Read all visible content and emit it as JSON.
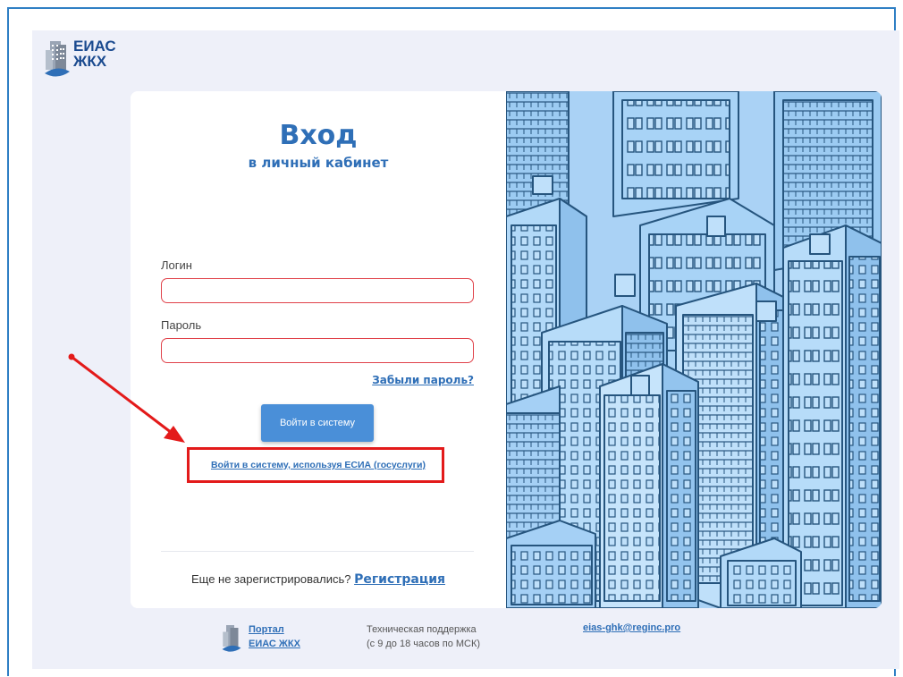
{
  "brand": {
    "logo_line1": "ЕИАС",
    "logo_line2": "ЖКХ"
  },
  "login": {
    "title": "Вход",
    "subtitle": "в личный кабинет",
    "login_label": "Логин",
    "login_value": "",
    "password_label": "Пароль",
    "password_value": "",
    "forgot_link": "Забыли пароль?",
    "submit_button": "Войти в систему",
    "esia_link": "Войти в систему, используя ЕСИА (госуслуги)",
    "register_prompt": "Еще не зарегистрировались?",
    "register_link": "Регистрация"
  },
  "footer": {
    "portal_line1": "Портал",
    "portal_line2": "ЕИАС ЖКХ",
    "support_line1": "Техническая поддержка",
    "support_line2": "(с 9 до 18 часов по МСК)",
    "email": "eias-ghk@reginc.pro"
  },
  "colors": {
    "accent": "#2f6fb7",
    "button": "#4a8fd8",
    "field_border": "#e0424a",
    "annotation": "#e31a1a",
    "illustration_bg": "#aad2f5"
  },
  "icons": [
    "building-logo-icon",
    "annotation-arrow-icon"
  ]
}
